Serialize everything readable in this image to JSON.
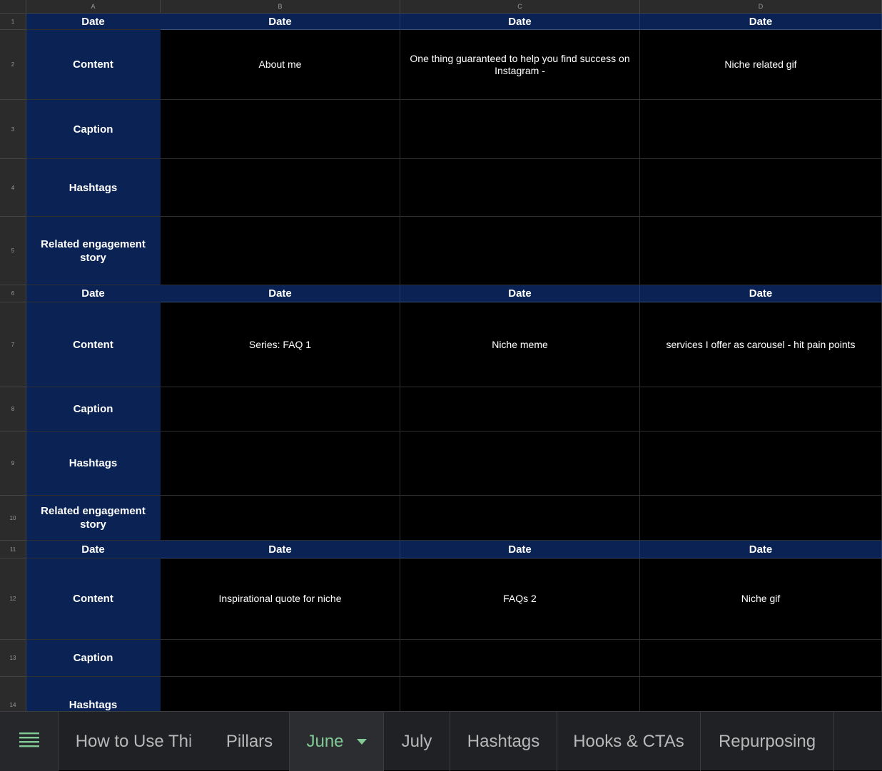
{
  "columns": [
    "A",
    "B",
    "C",
    "D"
  ],
  "rows": [
    {
      "num": "1",
      "label": "Date",
      "cells": [
        "Date",
        "Date",
        "Date"
      ]
    },
    {
      "num": "2",
      "label": "Content",
      "cells": [
        "About me",
        "One thing guaranteed to help you find success on Instagram -",
        "Niche related gif"
      ]
    },
    {
      "num": "3",
      "label": "Caption",
      "cells": [
        "",
        "",
        ""
      ]
    },
    {
      "num": "4",
      "label": "Hashtags",
      "cells": [
        "",
        "",
        ""
      ]
    },
    {
      "num": "5",
      "label": "Related engagement story",
      "cells": [
        "",
        "",
        ""
      ]
    },
    {
      "num": "6",
      "label": "Date",
      "cells": [
        "Date",
        "Date",
        "Date"
      ]
    },
    {
      "num": "7",
      "label": "Content",
      "cells": [
        "Series: FAQ 1",
        "Niche meme",
        "services I offer as carousel - hit pain points"
      ]
    },
    {
      "num": "8",
      "label": "Caption",
      "cells": [
        "",
        "",
        ""
      ]
    },
    {
      "num": "9",
      "label": "Hashtags",
      "cells": [
        "",
        "",
        ""
      ]
    },
    {
      "num": "10",
      "label": "Related engagement story",
      "cells": [
        "",
        "",
        ""
      ]
    },
    {
      "num": "11",
      "label": "Date",
      "cells": [
        "Date",
        "Date",
        "Date"
      ]
    },
    {
      "num": "12",
      "label": "Content",
      "cells": [
        "Inspirational quote for niche",
        "FAQs 2",
        "Niche gif"
      ]
    },
    {
      "num": "13",
      "label": "Caption",
      "cells": [
        "",
        "",
        ""
      ]
    },
    {
      "num": "14",
      "label": "Hashtags",
      "cells": [
        "",
        "",
        ""
      ]
    }
  ],
  "tabs": [
    {
      "label": "How to Use Thi",
      "active": false
    },
    {
      "label": "Pillars",
      "active": false
    },
    {
      "label": "June",
      "active": true
    },
    {
      "label": "July",
      "active": false
    },
    {
      "label": "Hashtags",
      "active": false
    },
    {
      "label": "Hooks & CTAs",
      "active": false
    },
    {
      "label": "Repurposing",
      "active": false
    }
  ],
  "icons": {
    "menu": "sheet-list-icon",
    "dropdown": "triangle-down-icon"
  },
  "colors": {
    "header_fill": "#0a2354",
    "active_tab": "#81c995",
    "background": "#000000"
  }
}
